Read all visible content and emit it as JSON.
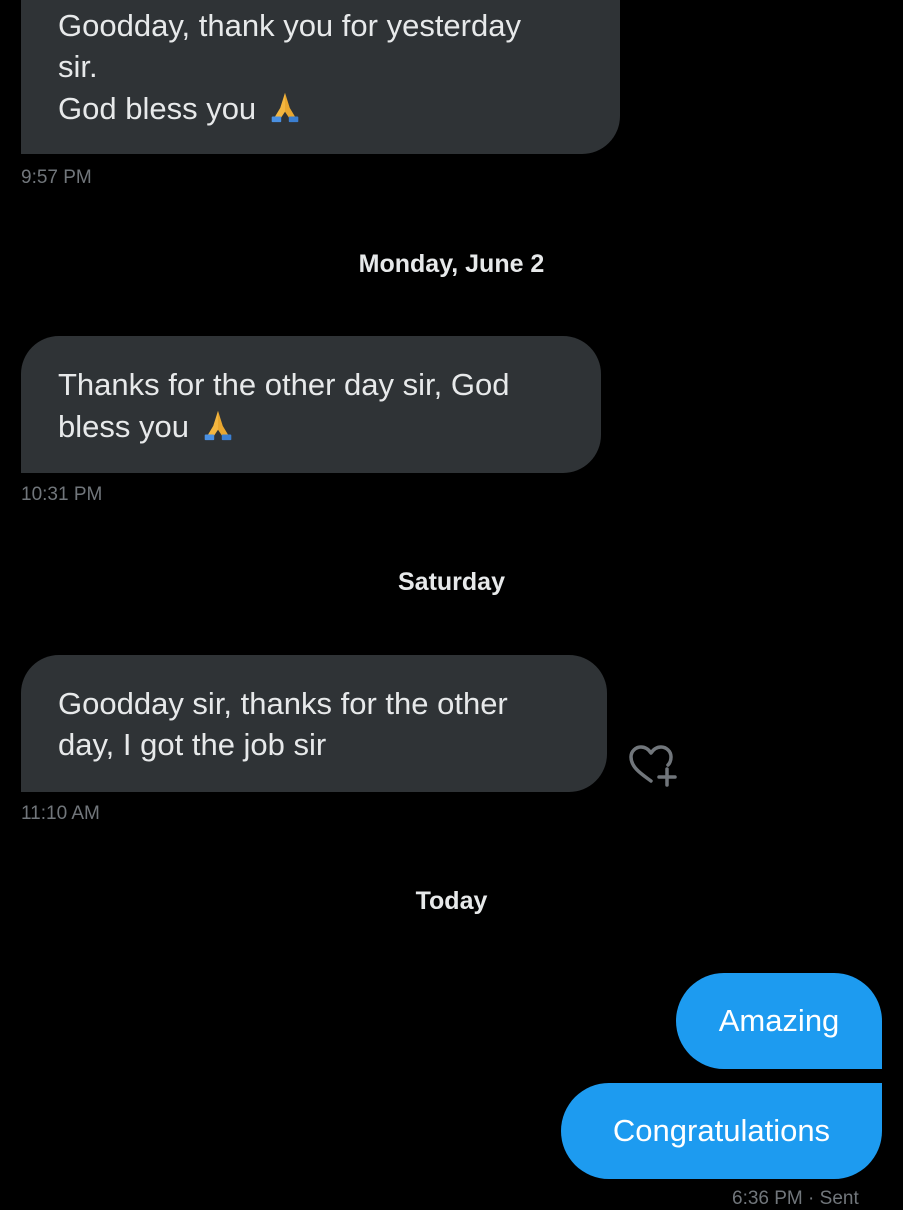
{
  "messages": [
    {
      "lines": [
        "Goodday, thank you for yesterday",
        "sir.",
        "God bless you"
      ],
      "emoji": "folded-hands",
      "time": "9:57 PM"
    },
    {
      "lines": [
        "Thanks for the other day sir, God",
        "bless you"
      ],
      "emoji": "folded-hands",
      "time": "10:31 PM"
    },
    {
      "lines": [
        "Goodday sir, thanks for the other",
        "day, I got the job sir"
      ],
      "time": "11:10 AM"
    }
  ],
  "day_separators": [
    "Monday, June 2",
    "Saturday",
    "Today"
  ],
  "outgoing": [
    {
      "text": "Amazing"
    },
    {
      "text": "Congratulations"
    }
  ],
  "outgoing_status": "6:36 PM · Sent",
  "colors": {
    "background": "#000000",
    "incoming_bubble": "#2f3336",
    "outgoing_bubble": "#1d9bf0",
    "muted_text": "#71767b"
  },
  "icons": {
    "emoji": "folded-hands-icon",
    "reaction": "add-reaction-heart-icon"
  }
}
